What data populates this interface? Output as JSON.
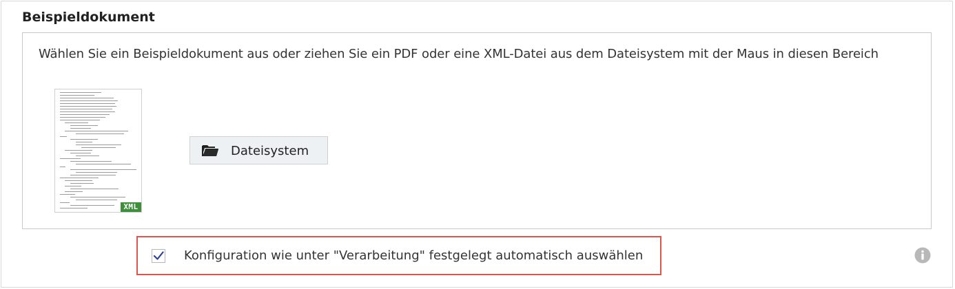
{
  "section": {
    "title": "Beispieldokument"
  },
  "dropzone": {
    "instruction": "Wählen Sie ein Beispieldokument aus oder ziehen Sie ein PDF oder eine XML-Datei aus dem Dateisystem mit der Maus in diesen Bereich",
    "sample_document": {
      "badge": "XML"
    },
    "filesystem_button": {
      "label": "Dateisystem",
      "icon": "folder-icon"
    }
  },
  "options": {
    "auto_select_config": {
      "label": "Konfiguration wie unter \"Verarbeitung\" festgelegt automatisch auswählen",
      "checked": true,
      "highlight_color": "#e0534a"
    },
    "info_icon": "info-icon"
  },
  "colors": {
    "checkmark": "#2a3f9e",
    "xml_badge": "#3f8e3a",
    "button_bg": "#eef1f3",
    "info_icon": "#b8b8b8"
  }
}
